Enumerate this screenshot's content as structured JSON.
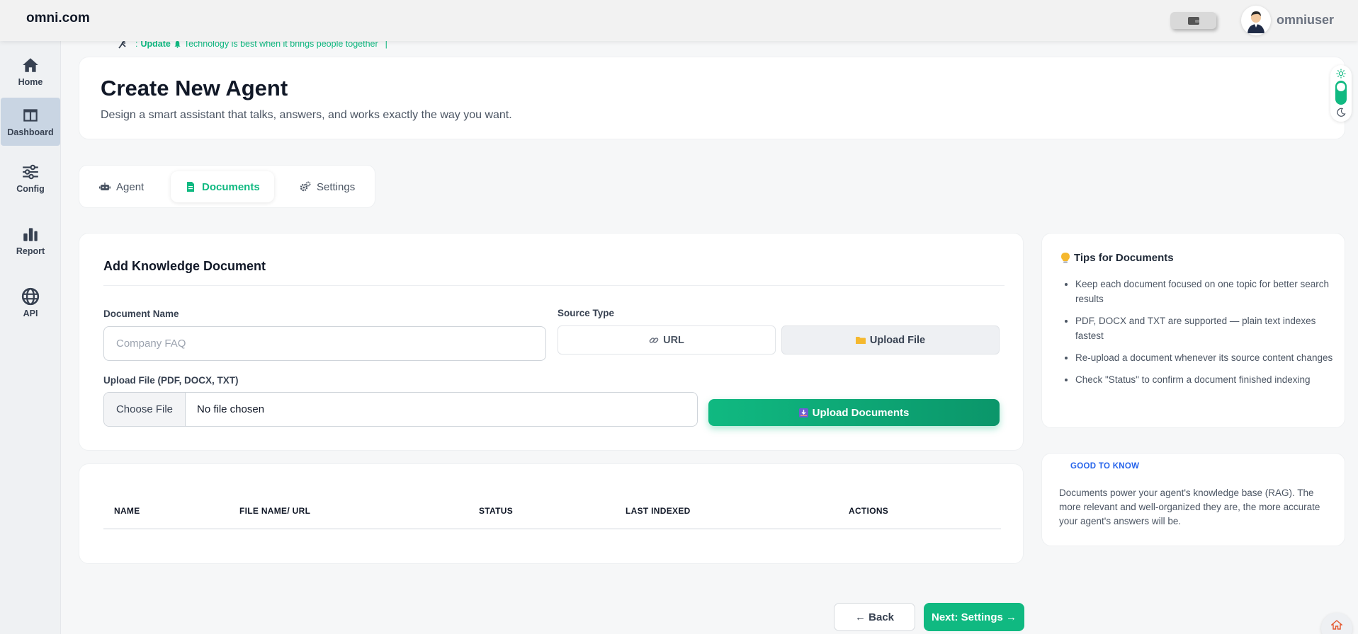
{
  "app": {
    "logo": "omni.com",
    "username": "omniuser"
  },
  "icons": {
    "wallet": "wallet-icon",
    "avatar": "user-avatar",
    "sun": "sun-icon",
    "moon": "moon-icon",
    "home_fab": "home-icon"
  },
  "sidebar": {
    "items": [
      {
        "label": "Home",
        "icon": "home-icon",
        "active": false
      },
      {
        "label": "Dashboard",
        "icon": "dashboard-icon",
        "active": true
      },
      {
        "label": "Config",
        "icon": "sliders-icon",
        "active": false
      },
      {
        "label": "Report",
        "icon": "bar-chart-icon",
        "active": false
      },
      {
        "label": "API",
        "icon": "globe-icon",
        "active": false
      }
    ]
  },
  "ticker": {
    "prefix": ":",
    "label": "Update",
    "text": "Technology is best when it brings people together",
    "separator": "|"
  },
  "header": {
    "title": "Create New Agent",
    "subtitle": "Design a smart assistant that talks, answers, and works exactly the way you want."
  },
  "tabs": [
    {
      "label": "Agent",
      "icon": "robot-icon",
      "active": false
    },
    {
      "label": "Documents",
      "icon": "document-icon",
      "active": true
    },
    {
      "label": "Settings",
      "icon": "gears-icon",
      "active": false
    }
  ],
  "form": {
    "title": "Add Knowledge Document",
    "doc_name_label": "Document Name",
    "doc_name_placeholder": "Company FAQ",
    "doc_name_value": "",
    "source_type_label": "Source Type",
    "source_url_label": "URL",
    "source_upload_label": "Upload File",
    "upload_label": "Upload File (PDF, DOCX, TXT)",
    "choose_file_label": "Choose File",
    "file_status": "No file chosen",
    "upload_button": "Upload Documents"
  },
  "table": {
    "columns": [
      "NAME",
      "FILE NAME/ URL",
      "STATUS",
      "LAST INDEXED",
      "ACTIONS"
    ],
    "rows": []
  },
  "tips": {
    "title": "Tips for Documents",
    "items": [
      "Keep each document focused on one topic for better search results",
      "PDF, DOCX and TXT are supported — plain text indexes fastest",
      "Re-upload a document whenever its source content changes",
      "Check \"Status\" to confirm a document finished indexing"
    ]
  },
  "good_to_know": {
    "badge": "GOOD TO KNOW",
    "text": "Documents power your agent's knowledge base (RAG). The more relevant and well-organized they are, the more accurate your agent's answers will be."
  },
  "footer": {
    "back_label": "← Back",
    "next_label": "Next: Settings →"
  },
  "colors": {
    "accent": "#10b981",
    "accent_dark": "#0b966a",
    "info": "#2563eb",
    "sidebar_active": "#c9d5e3"
  }
}
